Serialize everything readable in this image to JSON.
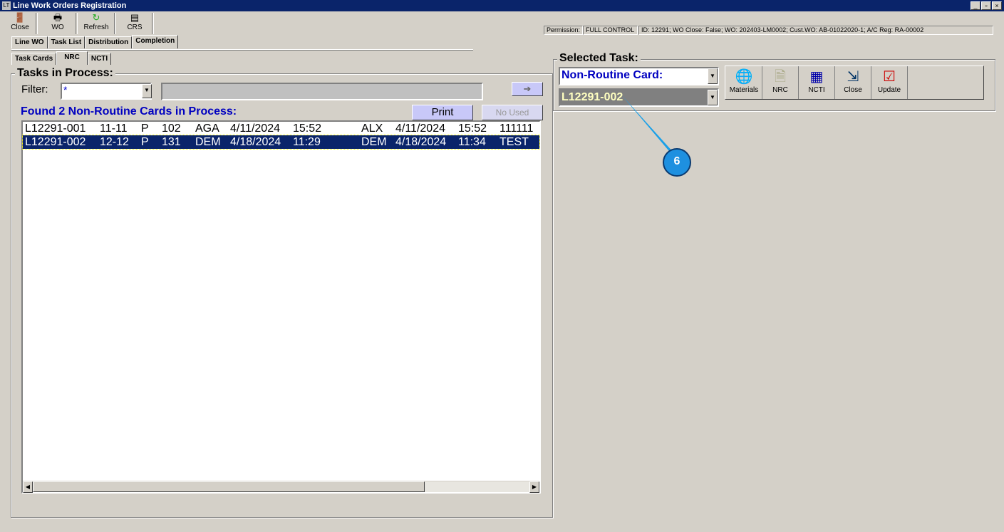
{
  "window": {
    "title": "Line Work Orders Registration",
    "app_icon": "LT"
  },
  "toolbar": [
    {
      "label": "Close",
      "icon": "door-exit-icon"
    },
    {
      "label": "WO",
      "icon": "printer-icon"
    },
    {
      "label": "Refresh",
      "icon": "refresh-icon"
    },
    {
      "label": "CRS",
      "icon": "certificate-icon"
    }
  ],
  "status": {
    "permission_label": "Permission:",
    "permission_value": "FULL CONTROL",
    "info": "ID: 12291; WO Close: False; WO: 202403-LM0002; Cust.WO: AB-01022020-1; A/C Reg: RA-00002"
  },
  "main_tabs": [
    "Line WO",
    "Task List",
    "Distribution",
    "Completion"
  ],
  "sub_tabs": [
    "Task Cards",
    "NRC",
    "NCTI"
  ],
  "tasks": {
    "title": "Tasks in Process:",
    "filter_label": "Filter:",
    "filter_value": "*",
    "found_text": "Found 2 Non-Routine Cards in Process:",
    "print": "Print",
    "no_used": "No Used",
    "rows": [
      [
        "L12291-001",
        "11-11",
        "P",
        "102",
        "AGA",
        "4/11/2024",
        "15:52",
        "ALX",
        "4/11/2024",
        "15:52",
        "111111"
      ],
      [
        "L12291-002",
        "12-12",
        "P",
        "131",
        "DEM",
        "4/18/2024",
        "11:29",
        "DEM",
        "4/18/2024",
        "11:34",
        "TEST"
      ]
    ]
  },
  "selected": {
    "title": "Selected Task:",
    "type_value": "Non-Routine Card:",
    "card_value": "L12291-002",
    "buttons": [
      {
        "label": "Materials",
        "icon": "materials-globe-icon"
      },
      {
        "label": "NRC",
        "icon": "nrc-document-icon"
      },
      {
        "label": "NCTI",
        "icon": "ncti-grid-icon"
      },
      {
        "label": "Close",
        "icon": "close-task-icon"
      },
      {
        "label": "Update",
        "icon": "update-checklist-icon"
      }
    ]
  },
  "annotation": {
    "number": "6"
  },
  "colors": {
    "accent": "#0a246a",
    "selected_row": "#0a246a",
    "label_blue": "#0000c0"
  }
}
